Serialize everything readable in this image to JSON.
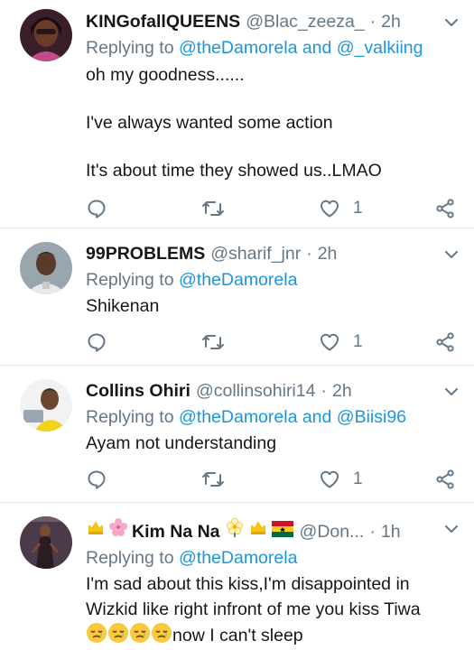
{
  "tweets": [
    {
      "name": "KINGofallQUEENS",
      "handle": "@Blac_zeeza_",
      "dot": "·",
      "time": "2h",
      "reply_prefix": "Replying to",
      "reply_mentions": "@theDamorela and @_valkiing",
      "body": "oh my goodness......\n\nI've always wanted some action\n\nIt's about time they showed us..LMAO",
      "like_count": "1"
    },
    {
      "name": "99PROBLEMS",
      "handle": "@sharif_jnr",
      "dot": "·",
      "time": "2h",
      "reply_prefix": "Replying to",
      "reply_mentions": "@theDamorela",
      "body": "Shikenan",
      "like_count": "1"
    },
    {
      "name": "Collins Ohiri",
      "handle": "@collinsohiri14",
      "dot": "·",
      "time": "2h",
      "reply_prefix": "Replying to",
      "reply_mentions": "@theDamorela and @Biisi96",
      "body": "Ayam not understanding",
      "like_count": "1"
    },
    {
      "name": "Kim Na Na",
      "handle": "@Don...",
      "dot": "·",
      "time": "1h",
      "reply_prefix": "Replying to",
      "reply_mentions": "@theDamorela",
      "body_line1": "I'm sad about this kiss,I'm disappointed in",
      "body_line2": "Wizkid like right infront of me you kiss Tiwa",
      "body_line3": "now I can't sleep"
    }
  ],
  "colors": {
    "text": "#14171a",
    "secondary": "#657786",
    "link": "#1b95e0",
    "divider": "#e6ecf0"
  },
  "icons": [
    "reply-icon",
    "retweet-icon",
    "like-icon",
    "share-icon",
    "chevron-down-icon"
  ]
}
